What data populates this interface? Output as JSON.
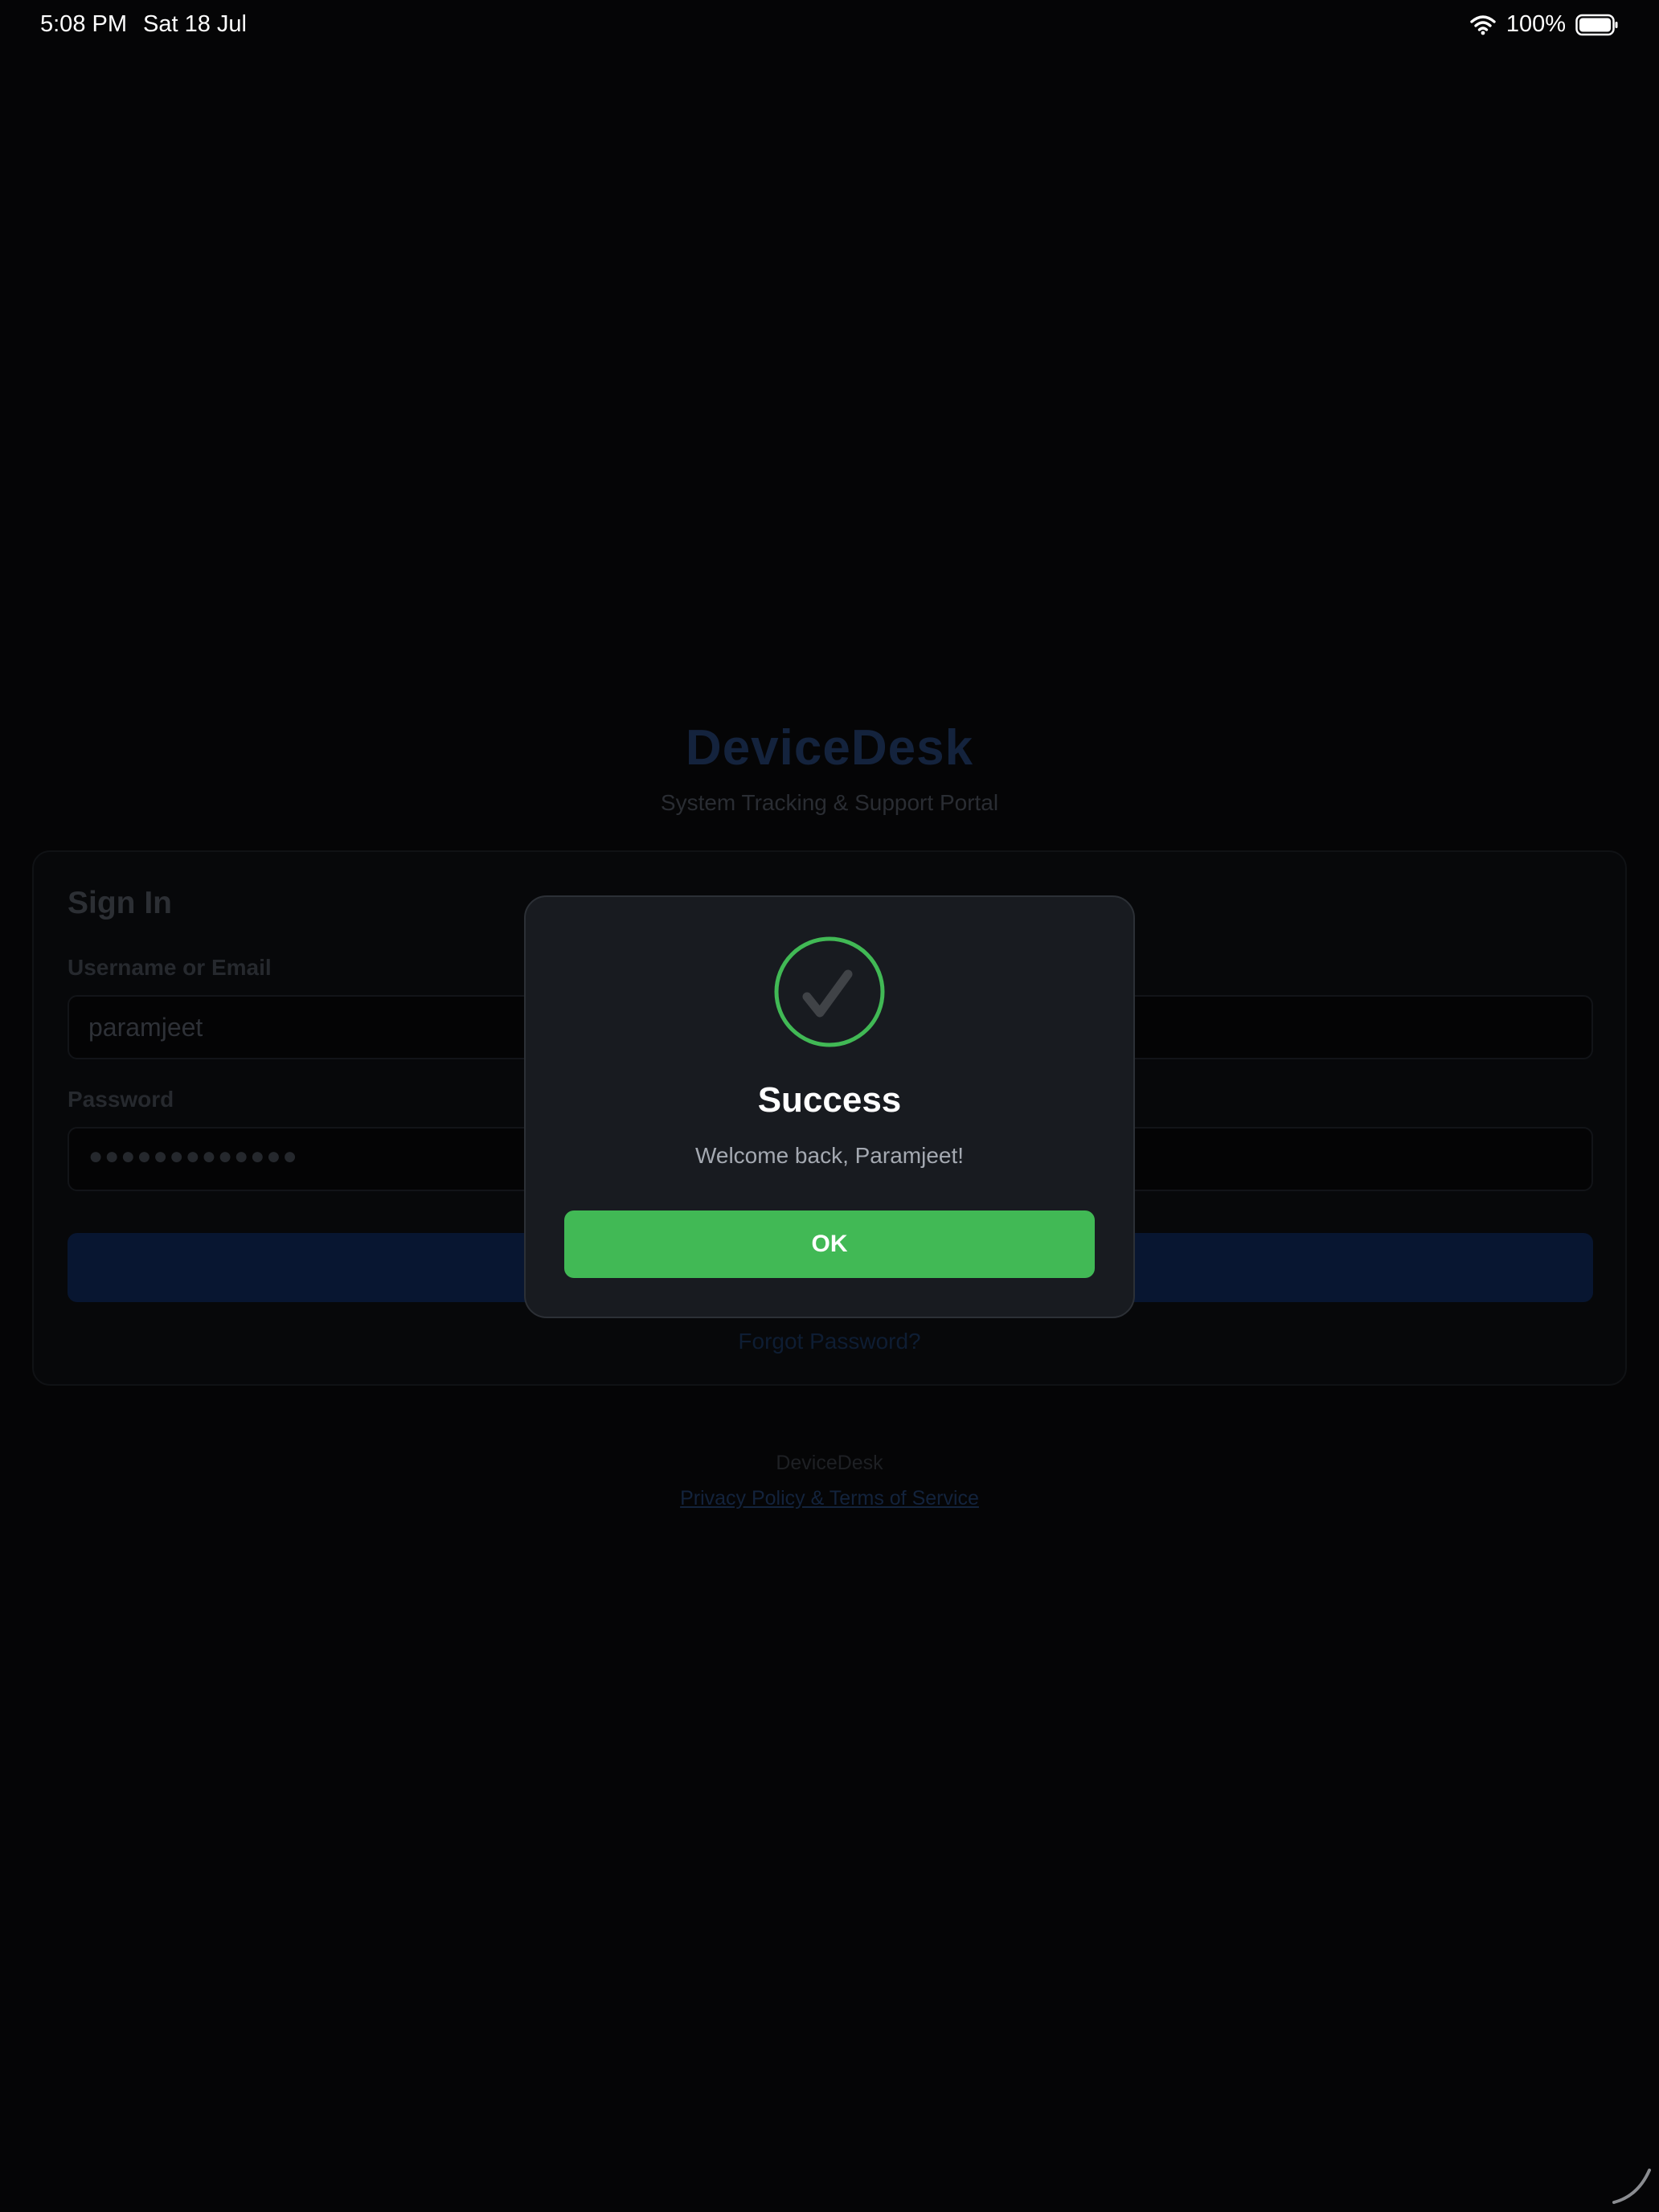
{
  "status_bar": {
    "time": "5:08 PM",
    "date": "Sat 18 Jul",
    "battery": "100%",
    "icons": [
      "wifi-icon",
      "battery-icon"
    ]
  },
  "login_page": {
    "brand_title": "DeviceDesk",
    "brand_subtitle": "System Tracking & Support Portal",
    "signin_heading": "Sign In",
    "username_label": "Username or Email",
    "username_value": "paramjeet",
    "password_label": "Password",
    "password_masked": "●●●●●●●●●●●●●",
    "forgot_password": "Forgot Password?",
    "footer_brand": "DeviceDesk",
    "footer_link": "Privacy Policy & Terms of Service"
  },
  "modal": {
    "icon": "checkmark-circle-icon",
    "title": "Success",
    "message": "Welcome back, Paramjeet!",
    "ok_label": "OK"
  },
  "colors": {
    "success_green": "#41b955",
    "brand_blue_dimmed": "#14233d",
    "modal_background": "#181b20"
  }
}
